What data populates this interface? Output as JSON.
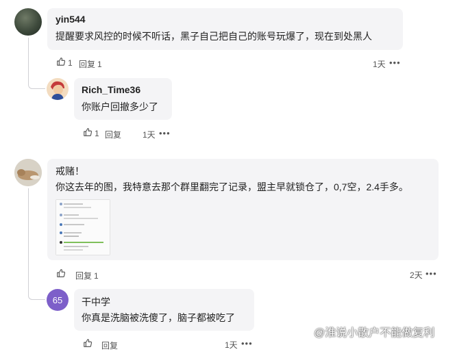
{
  "comments": [
    {
      "username": "yin544",
      "text": "提醒要求风控的时候不听话，黑子自己把自己的账号玩爆了，现在到处黑人",
      "likes": "1",
      "reply_label": "回复",
      "reply_count": "1",
      "time": "1天",
      "more": "•••"
    },
    {
      "username": "Rich_Time36",
      "text": "你账户回撤多少了",
      "likes": "1",
      "reply_label": "回复",
      "time": "1天",
      "more": "•••"
    },
    {
      "username": "戒赌！",
      "text": "你这去年的图，我特意去那个群里翻完了记录，盟主早就锁仓了，0,7空，2.4手多。",
      "reply_label": "回复",
      "reply_count": "1",
      "time": "2天",
      "more": "•••"
    },
    {
      "username": "干中学",
      "avatar_text": "65",
      "text": "你真是洗脑被洗傻了，脑子都被吃了",
      "reply_label": "回复",
      "time": "1天",
      "more": "•••"
    }
  ],
  "watermark": "@淮说小散户不能做复利",
  "colors": {
    "bubble": "#f4f4f6",
    "avatar_65": "#7d5fc9"
  }
}
